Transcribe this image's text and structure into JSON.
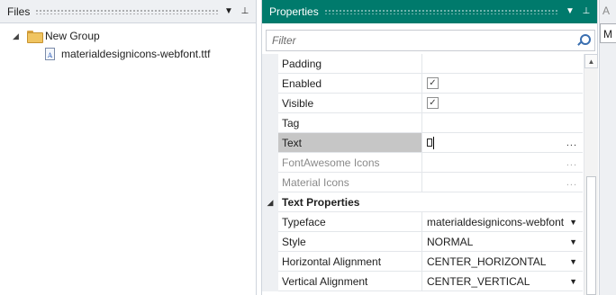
{
  "files_panel": {
    "title": "Files",
    "tree": {
      "group": {
        "label": "New Group",
        "expander": "◢"
      },
      "file": {
        "label": "materialdesignicons-webfont.ttf",
        "icon_letter": "A"
      }
    }
  },
  "properties_panel": {
    "title": "Properties",
    "filter_placeholder": "Filter",
    "rows": [
      {
        "name": "Padding",
        "value": ""
      },
      {
        "name": "Enabled",
        "checked": true
      },
      {
        "name": "Visible",
        "checked": true
      },
      {
        "name": "Tag",
        "value": ""
      },
      {
        "name": "Text",
        "ellipsis": "..."
      },
      {
        "name": "FontAwesome Icons",
        "ellipsis": "..."
      },
      {
        "name": "Material Icons",
        "ellipsis": "..."
      }
    ],
    "category": {
      "label": "Text Properties",
      "toggle": "◢"
    },
    "text_rows": [
      {
        "name": "Typeface",
        "value": "materialdesignicons-webfont"
      },
      {
        "name": "Style",
        "value": "NORMAL"
      },
      {
        "name": "Horizontal Alignment",
        "value": "CENTER_HORIZONTAL"
      },
      {
        "name": "Vertical Alignment",
        "value": "CENTER_VERTICAL"
      }
    ],
    "check_mark": "✓",
    "dropdown_arrow": "▼"
  },
  "right_strip": {
    "tab_label": "A",
    "box_label": "M"
  },
  "header_buttons": {
    "dropdown": "▼",
    "pin": "⊥"
  },
  "colors": {
    "accent": "#007a6c",
    "selected_row": "#c6c6c6"
  }
}
